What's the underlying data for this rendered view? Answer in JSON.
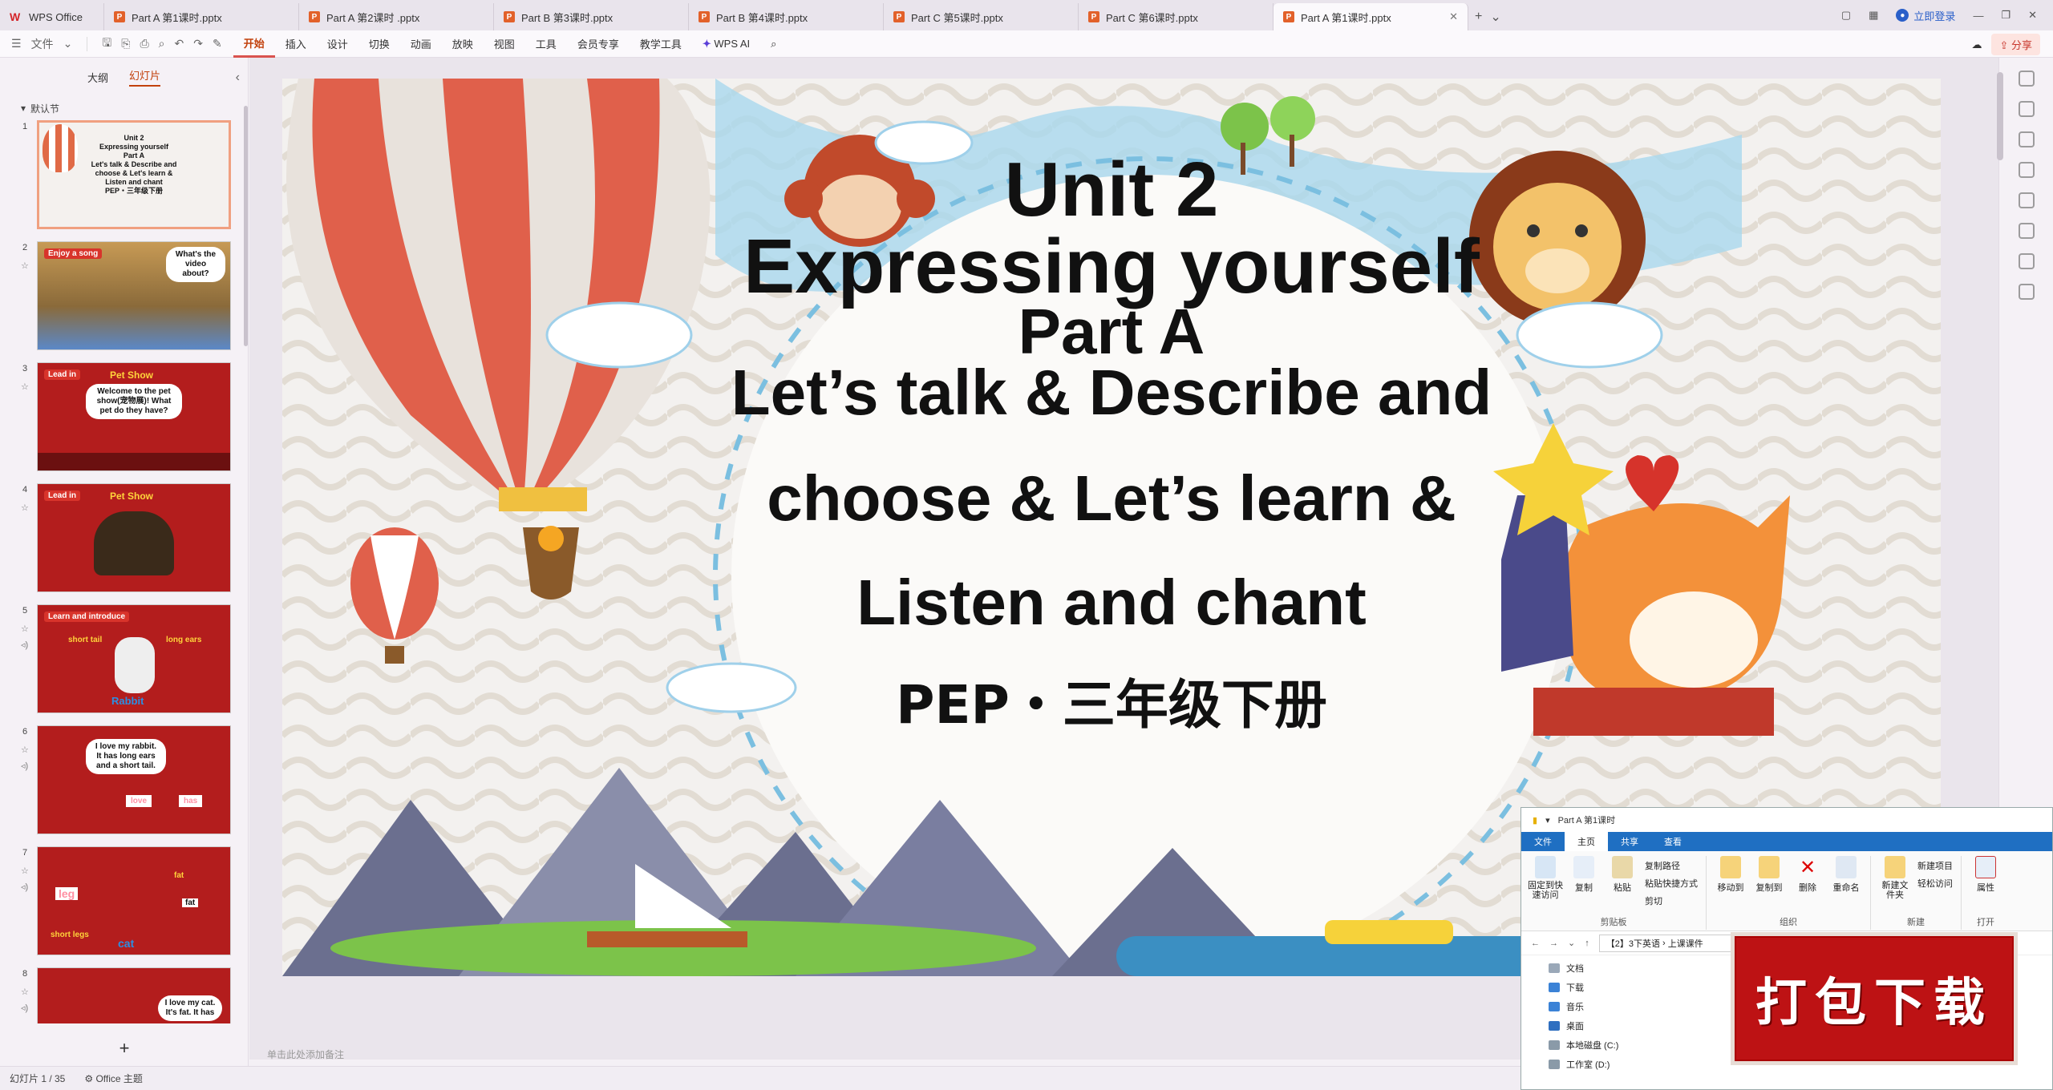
{
  "tabs": {
    "home": "WPS Office",
    "files": [
      {
        "label": "Part  A 第1课时.pptx",
        "active": false
      },
      {
        "label": "Part  A 第2课时 .pptx",
        "active": false
      },
      {
        "label": "Part  B 第3课时.pptx",
        "active": false
      },
      {
        "label": "Part  B 第4课时.pptx",
        "active": false
      },
      {
        "label": "Part  C 第5课时.pptx",
        "active": false
      },
      {
        "label": "Part  C 第6课时.pptx",
        "active": false
      },
      {
        "label": "Part  A 第1课时.pptx",
        "active": true
      }
    ],
    "login": "立即登录"
  },
  "menu": {
    "file": "文件",
    "items": [
      "开始",
      "插入",
      "设计",
      "切换",
      "动画",
      "放映",
      "视图",
      "工具",
      "会员专享",
      "教学工具"
    ],
    "wps_ai": "WPS AI",
    "share": "分享"
  },
  "left_panel": {
    "tab_outline": "大纲",
    "tab_slides": "幻灯片",
    "section": "默认节",
    "thumbs": [
      {
        "num": "1",
        "lines": [
          "Unit 2",
          "Expressing yourself",
          "Part A",
          "Let's talk & Describe and",
          "choose & Let's learn &",
          "Listen and chant",
          "PEP・三年级下册"
        ]
      },
      {
        "num": "2",
        "tag": "Enjoy a song",
        "bubble": "What's the video about?"
      },
      {
        "num": "3",
        "tag": "Lead in",
        "title": "Pet Show",
        "bubble": "Welcome to the pet show(宠物展)! What pet do they have?"
      },
      {
        "num": "4",
        "tag": "Lead in",
        "title": "Pet Show"
      },
      {
        "num": "5",
        "tag": "Learn and introduce",
        "words": [
          "short tail",
          "long ears",
          "Rabbit"
        ]
      },
      {
        "num": "6",
        "bubble": "I love my rabbit. It has long ears and a short tail.",
        "words": [
          "love",
          "has"
        ]
      },
      {
        "num": "7",
        "words": [
          "leg",
          "fat",
          "fat",
          "short legs",
          "cat"
        ]
      },
      {
        "num": "8",
        "bubble": "I love my cat. It's fat. It has"
      }
    ]
  },
  "slide": {
    "line1": "Unit 2",
    "line2": "Expressing yourself",
    "line3": "Part A",
    "line4": "Let’s talk & Describe and",
    "line5": "choose & Let’s learn &",
    "line6": "Listen and chant",
    "line7": "PEP・三年级下册"
  },
  "notes_placeholder": "单击此处添加备注",
  "status": {
    "slide_count": "幻灯片 1 / 35",
    "theme": "Office 主题"
  },
  "explorer": {
    "title": "Part  A 第1课时",
    "tabs": [
      "文件",
      "主页",
      "共享",
      "查看"
    ],
    "clipboard": {
      "pin": "固定到快速访问",
      "copy": "复制",
      "paste": "粘贴",
      "copy_path": "复制路径",
      "paste_shortcut": "粘贴快捷方式",
      "cut": "剪切",
      "group": "剪贴板"
    },
    "organize": {
      "move": "移动到",
      "copy_to": "复制到",
      "delete": "删除",
      "rename": "重命名",
      "group": "组织"
    },
    "new": {
      "new_folder": "新建文件夹",
      "new_item": "新建项目",
      "easy_access": "轻松访问",
      "group": "新建"
    },
    "open": {
      "props": "属性",
      "group": "打开"
    },
    "address": [
      "【2】3下英语",
      "上课课件"
    ],
    "tree": [
      "文档",
      "下载",
      "音乐",
      "桌面",
      "本地磁盘 (C:)",
      "工作室 (D:)"
    ]
  },
  "download_banner": "打包下载",
  "colors": {
    "accent": "#c2410c",
    "banner": "#bd1214"
  }
}
